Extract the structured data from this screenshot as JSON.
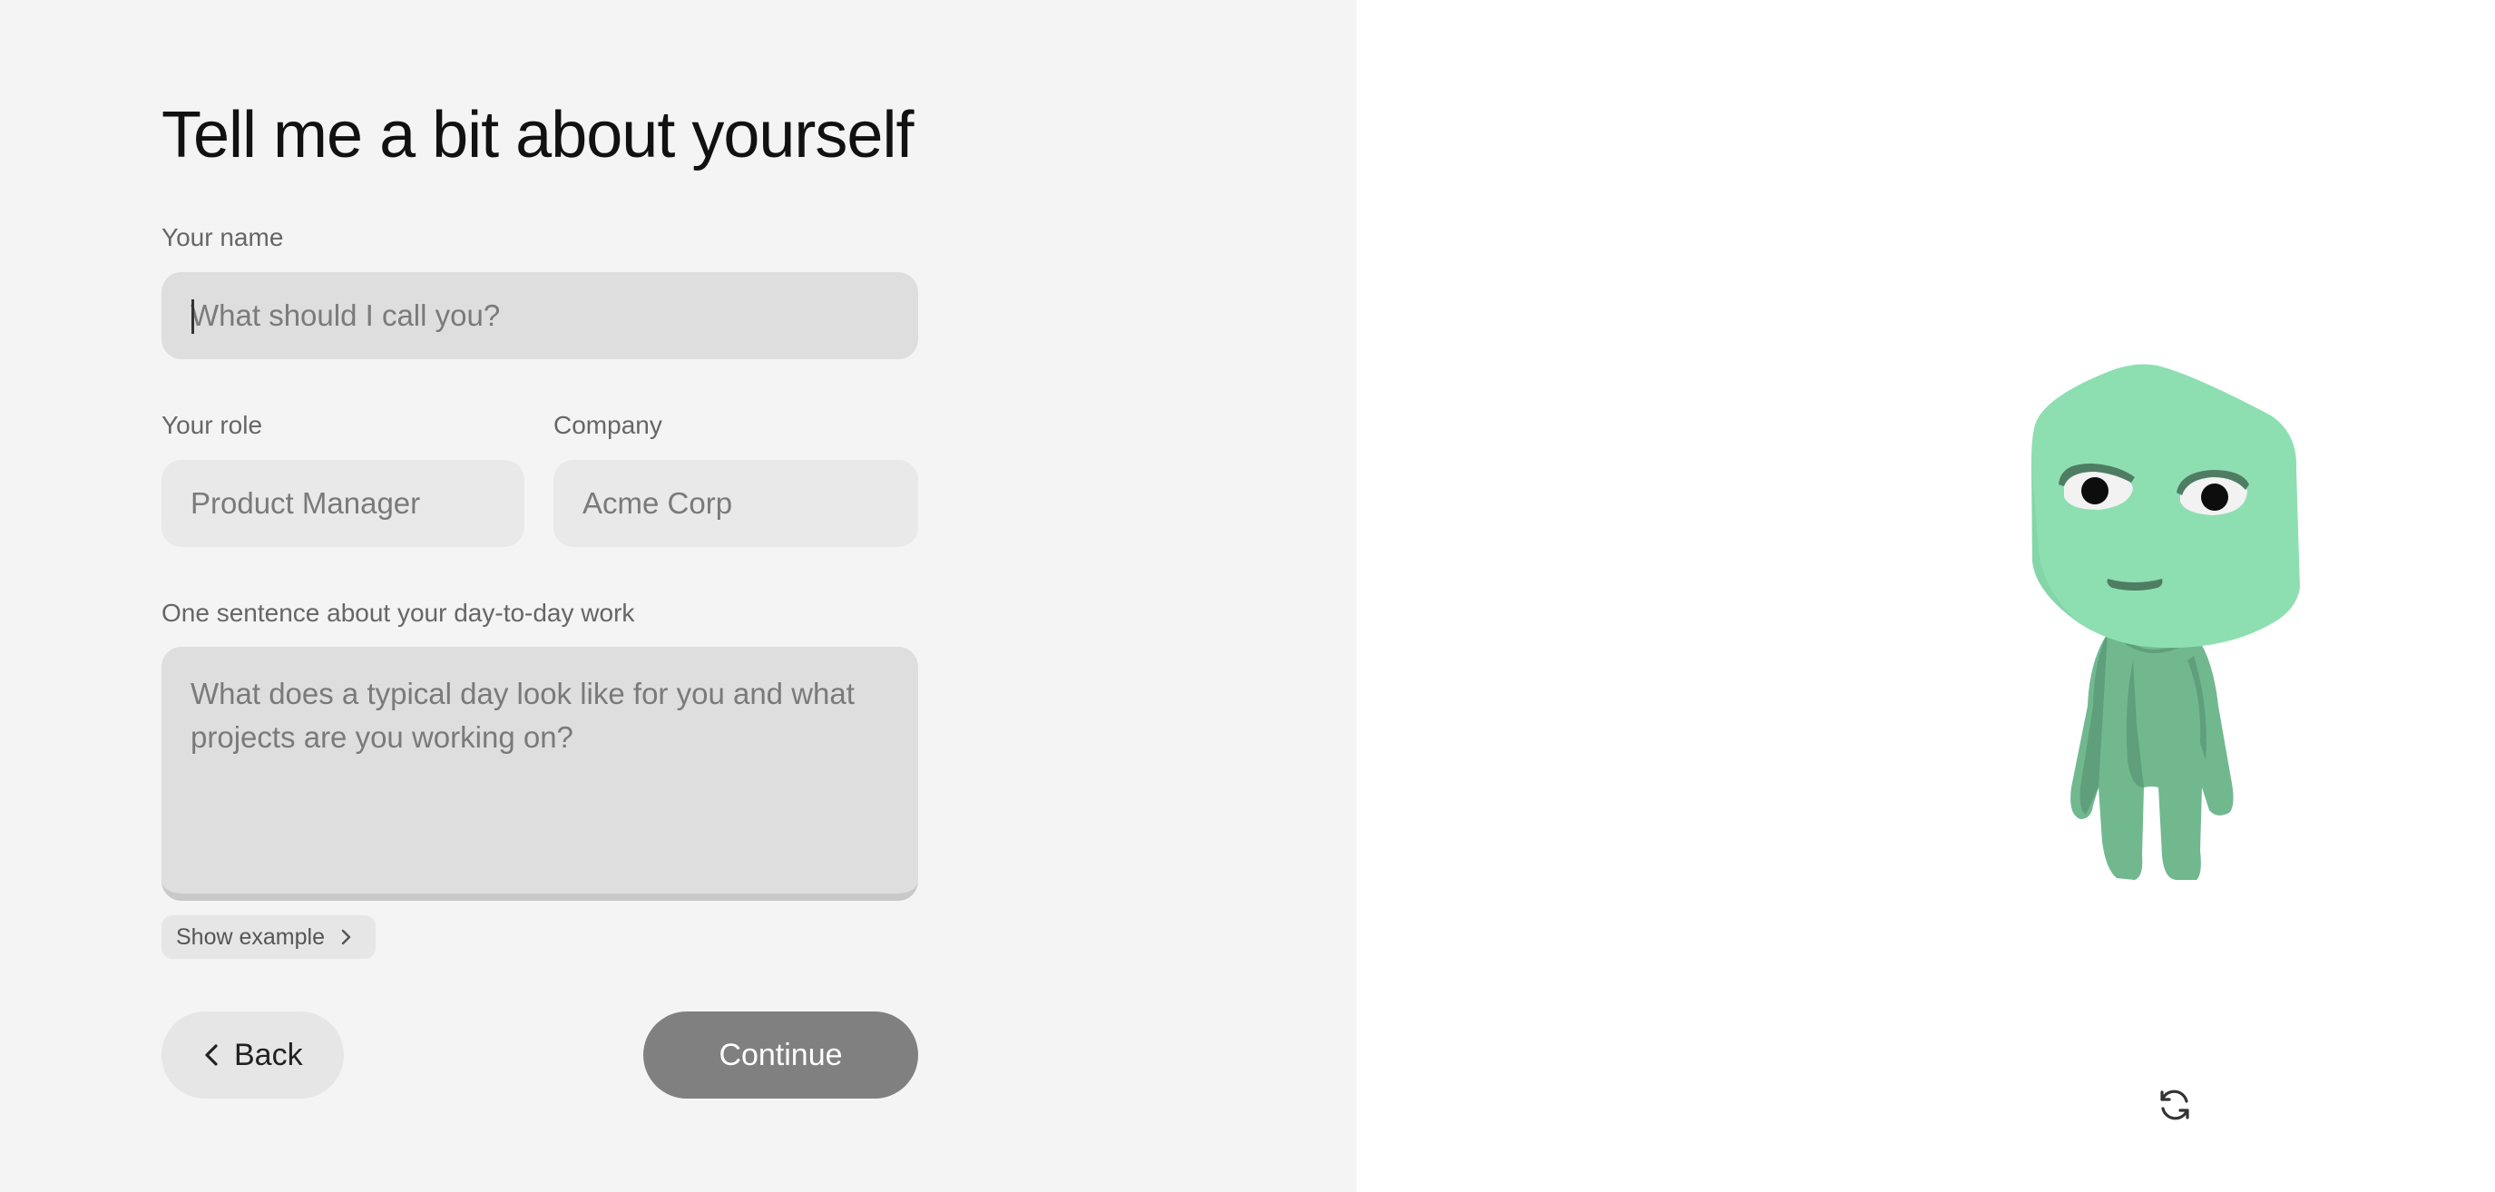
{
  "form": {
    "title": "Tell me a bit about yourself",
    "name": {
      "label": "Your name",
      "placeholder": "What should I call you?",
      "value": ""
    },
    "role": {
      "label": "Your role",
      "placeholder": "Product Manager",
      "value": ""
    },
    "company": {
      "label": "Company",
      "placeholder": "Acme Corp",
      "value": ""
    },
    "work": {
      "label": "One sentence about your day-to-day work",
      "placeholder": "What does a typical day look like for you and what projects are you working on?",
      "value": ""
    },
    "show_example_label": "Show example",
    "back_label": "Back",
    "continue_label": "Continue"
  },
  "avatar": {
    "icon": "green-character-avatar",
    "colors": {
      "head": "#8ddfb1",
      "body": "#71b88f",
      "body_shadow": "#5f9f7b",
      "eye_white": "#f2f2f2",
      "pupil": "#0d0d0d",
      "brow": "#4f7d63"
    }
  },
  "refresh": {
    "icon": "refresh-icon"
  },
  "colors": {
    "left_panel": "#f4f4f4",
    "right_panel": "#ffffff",
    "continue_bg": "#808080",
    "field_active_bg": "#dedede",
    "field_bg": "#e9e9e9"
  }
}
